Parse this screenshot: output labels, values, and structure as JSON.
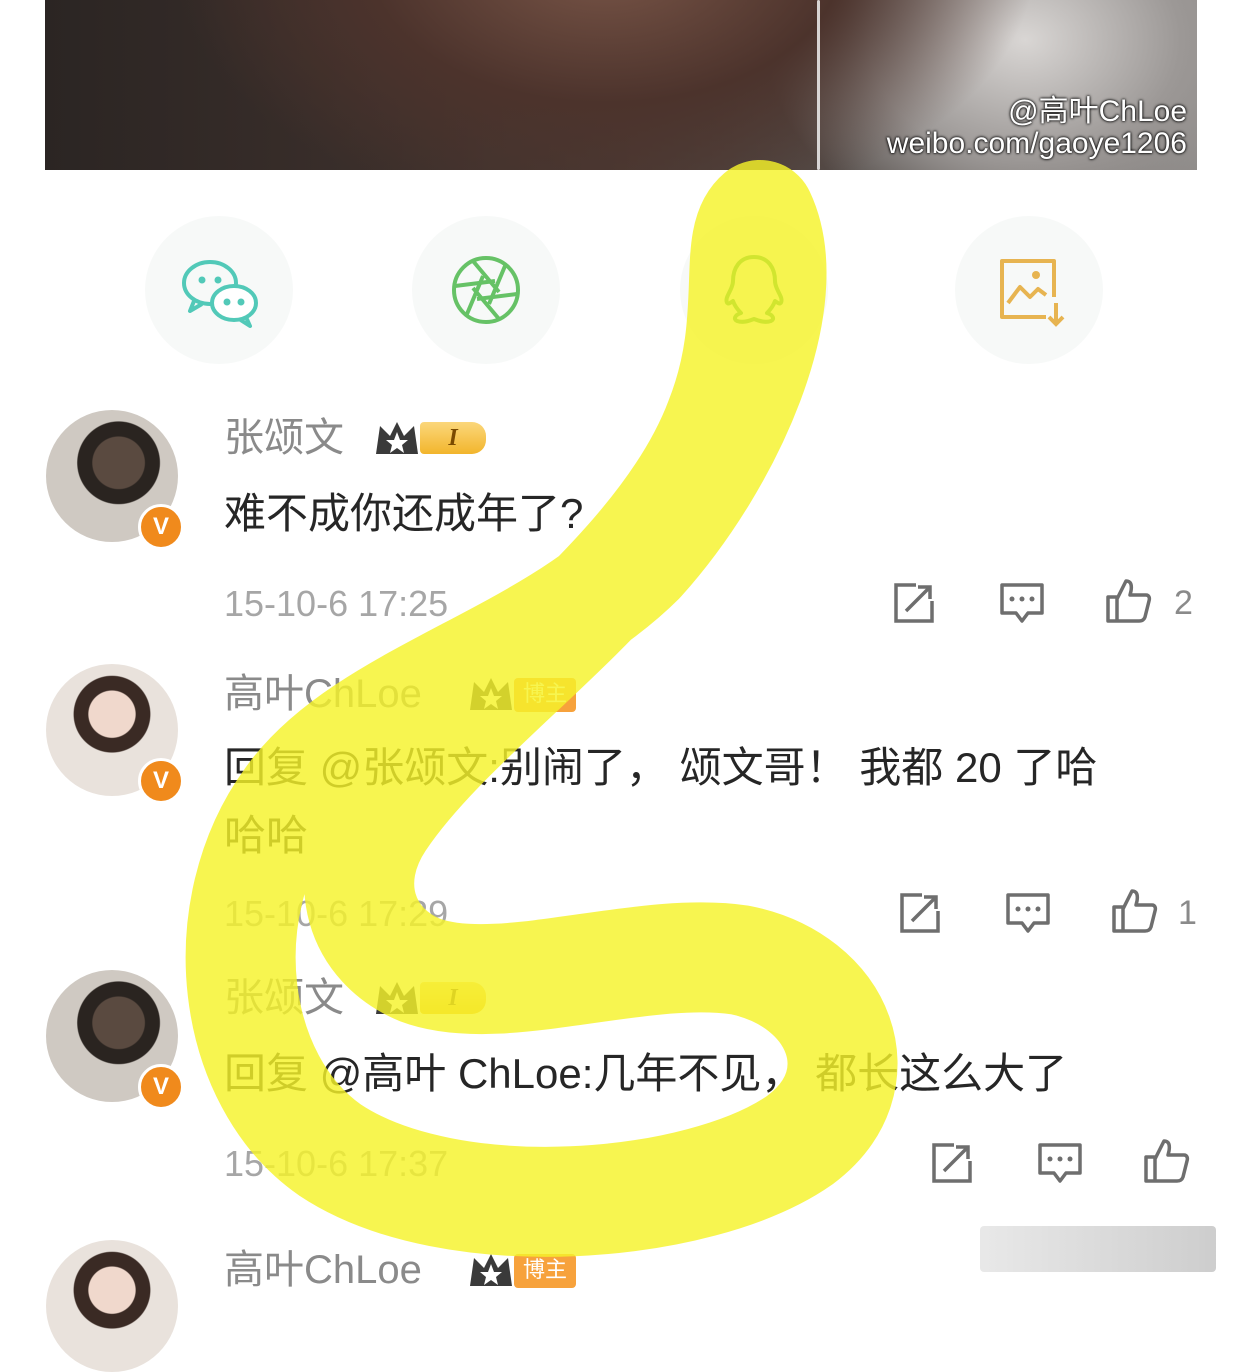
{
  "photo": {
    "watermark_handle": "@高叶ChLoe",
    "watermark_url": "weibo.com/gaoye1206"
  },
  "share": {
    "icons": [
      "wechat-icon",
      "moments-icon",
      "qq-icon",
      "save-image-icon"
    ],
    "colors": {
      "wechat": "#52c9b8",
      "moments": "#66c266",
      "qq": "#2fa84a",
      "save": "#e7b451"
    }
  },
  "highlight_color": "#f5f32a",
  "comments": [
    {
      "user": "张颂文",
      "badge": "I",
      "text_lines": [
        "难不成你还成年了?"
      ],
      "time": "15-10-6 17:25",
      "likes": "2"
    },
    {
      "user": "高叶ChLoe",
      "badge": "博主",
      "text_lines": [
        "回复 @张颂文:别闹了， 颂文哥！ 我都 20 了哈",
        "哈哈"
      ],
      "time": "15-10-6 17:29",
      "likes": "1"
    },
    {
      "user": "张颂文",
      "badge": "I",
      "text_lines": [
        "回复 @高叶 ChLoe:几年不见， 都长这么大了"
      ],
      "time": "15-10-6 17:37",
      "likes": ""
    },
    {
      "user": "高叶ChLoe",
      "badge": "博主"
    }
  ]
}
